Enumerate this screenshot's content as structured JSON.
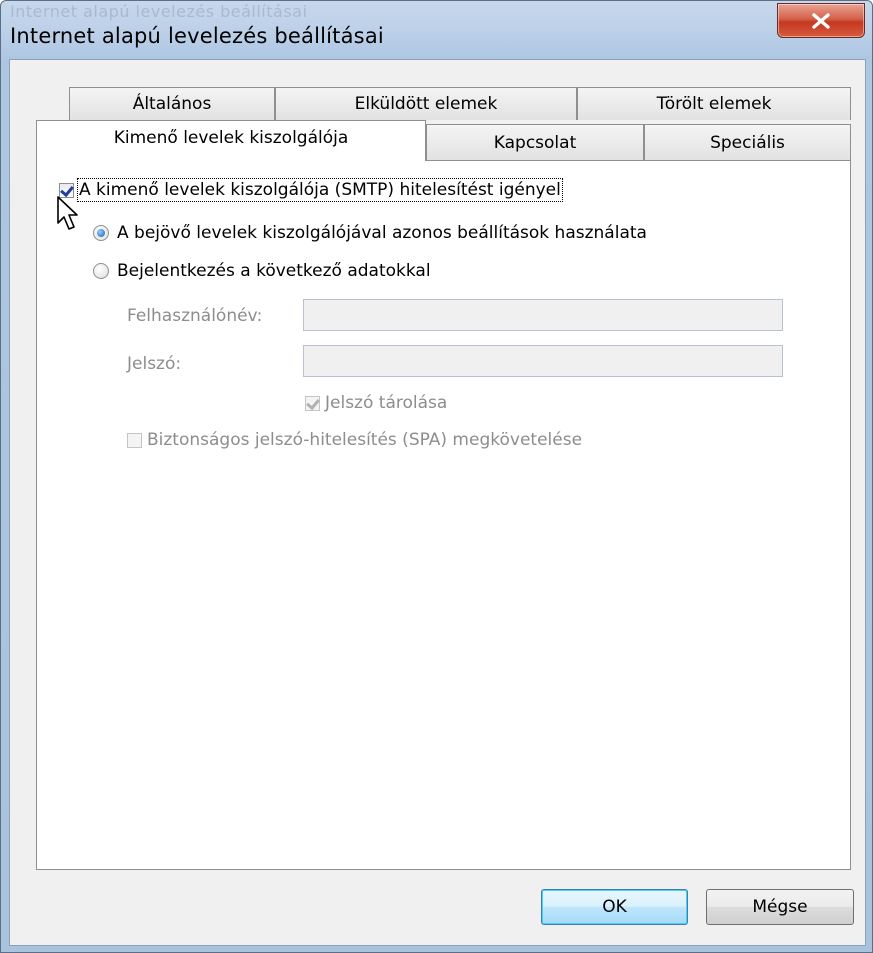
{
  "window": {
    "title": "Internet alapú levelezés beállításai",
    "title_ghost": "Internet alapú levelezés beállításai",
    "close_icon": "close-icon"
  },
  "tabs": {
    "row_back": [
      {
        "label": "Általános"
      },
      {
        "label": "Elküldött elemek"
      },
      {
        "label": "Törölt elemek"
      }
    ],
    "row_front": [
      {
        "label": "Kimenő levelek kiszolgálója",
        "active": true
      },
      {
        "label": "Kapcsolat"
      },
      {
        "label": "Speciális"
      }
    ]
  },
  "smtp": {
    "requires_auth_label": "A kimenő levelek kiszolgálója (SMTP) hitelesítést igényel",
    "requires_auth_checked": true,
    "use_same_label": "A bejövő levelek kiszolgálójával azonos beállítások használata",
    "use_same_selected": true,
    "login_with_label": "Bejelentkezés a következő adatokkal",
    "login_with_selected": false,
    "username_label": "Felhasználónév:",
    "username_value": "",
    "password_label": "Jelszó:",
    "password_value": "",
    "remember_password_label": "Jelszó tárolása",
    "remember_password_checked": true,
    "spa_label": "Biztonságos jelszó-hitelesítés (SPA) megkövetelése",
    "spa_checked": false
  },
  "buttons": {
    "ok": "OK",
    "cancel": "Mégse"
  },
  "colors": {
    "accent": "#3c7fb1",
    "close": "#c5381f"
  }
}
